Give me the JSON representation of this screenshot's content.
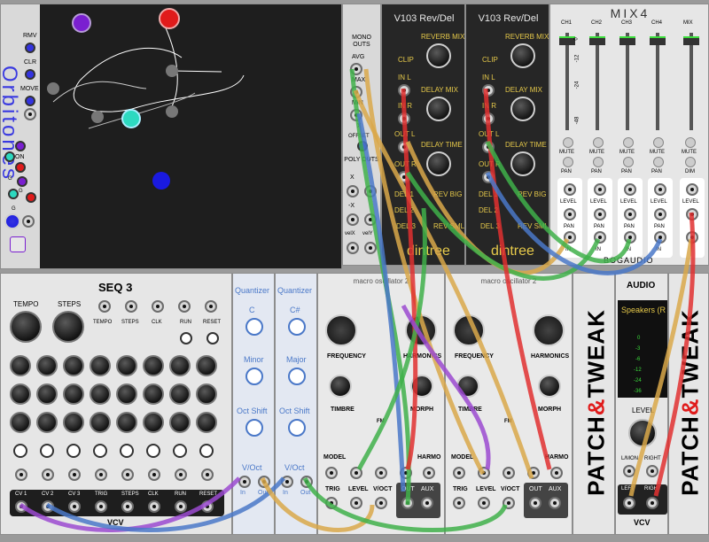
{
  "orbitones": {
    "title": "Orbitones",
    "labels": [
      "RMV",
      "CLR",
      "MOVE",
      "ON",
      "G",
      "G",
      "G"
    ]
  },
  "mono": {
    "title": "MONO OUTS",
    "labels": [
      "AVG",
      "MAX",
      "MIN",
      "X",
      "OFFSET",
      "POLY OUTS",
      "X",
      "-X",
      "velX",
      "velY"
    ]
  },
  "v103": [
    {
      "title": "V103 Rev/Del",
      "knobs": [
        "REVERB MIX",
        "DELAY MIX",
        "DELAY TIME",
        "REV BIG",
        "REV SML"
      ],
      "jacks": [
        "CLIP",
        "IN L",
        "IN R",
        "OUT L",
        "OUT R",
        "DEL 1",
        "DEL 2",
        "DEL 3"
      ],
      "brand": "dintree"
    },
    {
      "title": "V103 Rev/Del",
      "knobs": [
        "REVERB MIX",
        "DELAY MIX",
        "DELAY TIME",
        "REV BIG",
        "REV SML"
      ],
      "jacks": [
        "CLIP",
        "IN L",
        "IN R",
        "OUT L",
        "OUT R",
        "DEL 1",
        "DEL 2",
        "DEL 3"
      ],
      "brand": "dintree"
    }
  ],
  "mix4": {
    "title": "MIX4",
    "channels": [
      "CH1",
      "CH2",
      "CH3",
      "CH4",
      "MIX"
    ],
    "scale": [
      "0",
      "-12",
      "-24",
      "-48"
    ],
    "mute": "MUTE",
    "pan": "PAN",
    "dim": "DIM",
    "level": "LEVEL",
    "in": "IN",
    "brand": "BOGAUDIO"
  },
  "seq3": {
    "title": "SEQ 3",
    "top_labels": [
      "TEMPO",
      "STEPS"
    ],
    "small_labels": [
      "TEMPO",
      "STEPS",
      "CLK",
      "RUN",
      "RESET"
    ],
    "bottom_labels": [
      "CV 1",
      "CV 2",
      "CV 3",
      "TRIG",
      "STEPS",
      "CLK",
      "RUN",
      "RESET"
    ],
    "brand": "VCV"
  },
  "quantizers": [
    {
      "title": "Quantizer",
      "root": "C",
      "scale": "Minor",
      "shift": "Oct Shift",
      "voct": "V/Oct",
      "in": "In",
      "out": "Out"
    },
    {
      "title": "Quantizer",
      "root": "C#",
      "scale": "Major",
      "shift": "Oct Shift",
      "voct": "V/Oct",
      "in": "In",
      "out": "Out"
    }
  ],
  "macro": [
    {
      "title": "macro oscillator 2",
      "labels": [
        "FREQUENCY",
        "HARMONICS",
        "TIMBRE",
        "MORPH",
        "FM",
        "MODEL",
        "HARMO",
        "TRIG",
        "LEVEL",
        "V/OCT",
        "OUT",
        "AUX"
      ]
    },
    {
      "title": "macro oscillator 2",
      "labels": [
        "FREQUENCY",
        "HARMONICS",
        "TIMBRE",
        "MORPH",
        "FM",
        "MODEL",
        "HARMO",
        "TRIG",
        "LEVEL",
        "V/OCT",
        "OUT",
        "AUX"
      ]
    }
  ],
  "patch_tweak": [
    "PATCH",
    "&",
    "TWEAK"
  ],
  "audio": {
    "title": "AUDIO",
    "device": "Speakers (R",
    "meter": [
      "0",
      "-3",
      "-6",
      "-12",
      "-24",
      "-36"
    ],
    "level": "LEVEL",
    "io": [
      "L/MON",
      "RIGHT",
      "LEFT",
      "RIGHT"
    ],
    "brand": "VCV"
  },
  "colors": {
    "panel": "#e6e6e6",
    "dark_panel": "#262626",
    "accent_red": "#e01b1b",
    "quantizer_blue": "#4a78c8",
    "orbit_purple": "#7a1fd0",
    "orbit_teal": "#2dd9c0",
    "orbit_blue": "#1a1ae0"
  }
}
